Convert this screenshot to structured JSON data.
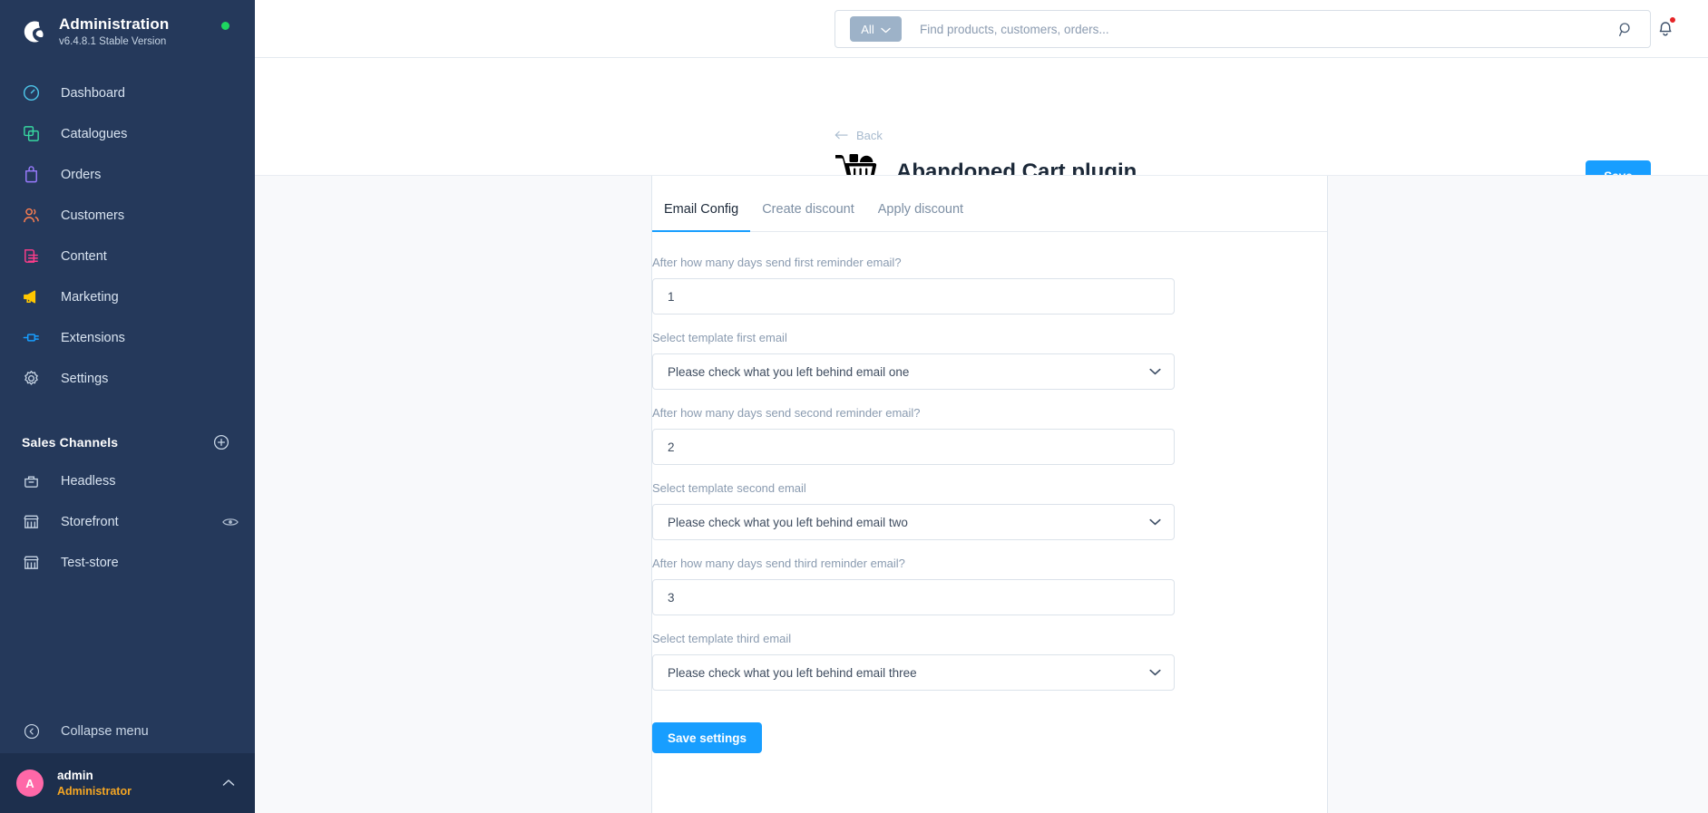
{
  "sidebar": {
    "brand": {
      "title": "Administration",
      "version": "v6.4.8.1 Stable Version",
      "status_dot_color": "#1ed760"
    },
    "items": [
      {
        "label": "Dashboard",
        "icon": "dashboard-icon",
        "color": "#4dc6ea"
      },
      {
        "label": "Catalogues",
        "icon": "catalogues-icon",
        "color": "#37d7a0"
      },
      {
        "label": "Orders",
        "icon": "orders-icon",
        "color": "#9a7bff"
      },
      {
        "label": "Customers",
        "icon": "customers-icon",
        "color": "#ff7f50"
      },
      {
        "label": "Content",
        "icon": "content-icon",
        "color": "#ff3d8b"
      },
      {
        "label": "Marketing",
        "icon": "marketing-icon",
        "color": "#ffc700"
      },
      {
        "label": "Extensions",
        "icon": "extensions-icon",
        "color": "#189eff"
      },
      {
        "label": "Settings",
        "icon": "gear-icon",
        "color": "#c6d4e4"
      }
    ],
    "sales_channels": {
      "title": "Sales Channels",
      "add_label": "+",
      "items": [
        {
          "label": "Headless",
          "icon": "headless-icon"
        },
        {
          "label": "Storefront",
          "icon": "storefront-icon",
          "has_preview_eye": true
        },
        {
          "label": "Test-store",
          "icon": "storefront-icon"
        }
      ]
    },
    "collapse": {
      "label": "Collapse menu",
      "icon": "collapse-icon"
    },
    "user": {
      "avatar_initial": "A",
      "avatar_color": "#ff68a8",
      "name": "admin",
      "role": "Administrator",
      "caret": "chevron-up-icon"
    }
  },
  "topbar": {
    "search": {
      "scope_label": "All",
      "placeholder": "Find products, customers, orders...",
      "value": ""
    },
    "notifications": {
      "icon": "bell-icon",
      "has_unread": true,
      "dot_color": "#e52427"
    }
  },
  "page": {
    "back_label": "Back",
    "title": "Abandoned Cart plugin",
    "icon": "shopping-cart-icon",
    "save_label": "Save",
    "accent_color": "#189eff"
  },
  "tabs": [
    {
      "label": "Email Config",
      "active": true
    },
    {
      "label": "Create discount",
      "active": false
    },
    {
      "label": "Apply discount",
      "active": false
    }
  ],
  "form": {
    "fields": [
      {
        "label": "After how many days send first reminder email?",
        "type": "input",
        "value": "1"
      },
      {
        "label": "Select template first email",
        "type": "select",
        "value": "Please check what you left behind email one"
      },
      {
        "label": "After how many days send second reminder email?",
        "type": "input",
        "value": "2"
      },
      {
        "label": "Select template second email",
        "type": "select",
        "value": "Please check what you left behind email two"
      },
      {
        "label": "After how many days send third reminder email?",
        "type": "input",
        "value": "3"
      },
      {
        "label": "Select template third email",
        "type": "select",
        "value": "Please check what you left behind email three"
      }
    ],
    "submit_label": "Save settings"
  }
}
